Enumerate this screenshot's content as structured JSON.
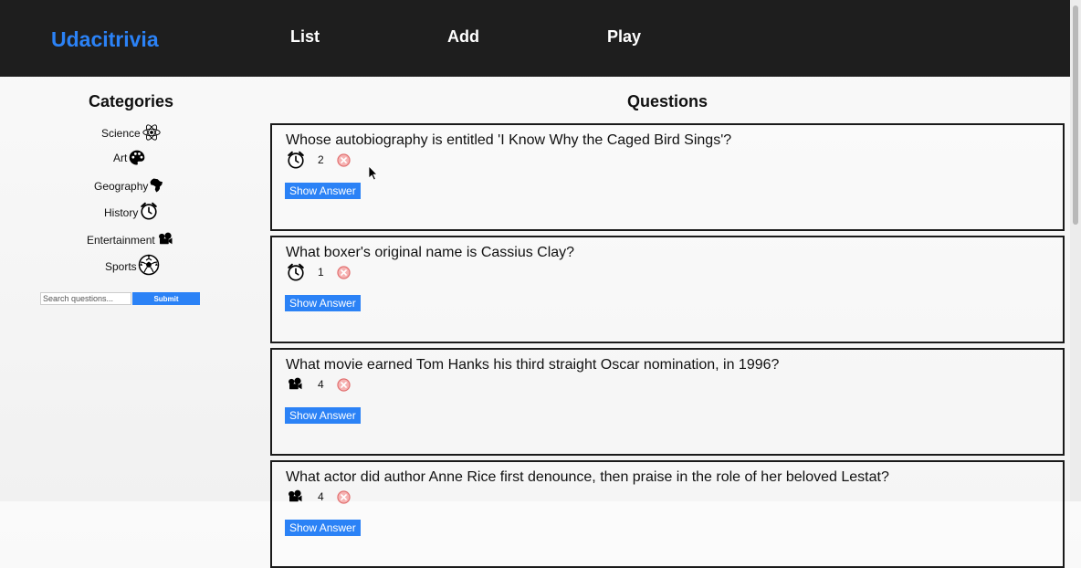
{
  "header": {
    "brand": "Udacitrivia",
    "nav": [
      {
        "label": "List"
      },
      {
        "label": "Add"
      },
      {
        "label": "Play"
      }
    ]
  },
  "sidebar": {
    "title": "Categories",
    "categories": [
      {
        "label": "Science",
        "icon": "atom-icon"
      },
      {
        "label": "Art",
        "icon": "palette-icon"
      },
      {
        "label": "Geography",
        "icon": "africa-map-icon"
      },
      {
        "label": "History",
        "icon": "alarm-clock-icon"
      },
      {
        "label": "Entertainment",
        "icon": "film-camera-icon"
      },
      {
        "label": "Sports",
        "icon": "soccer-ball-icon"
      }
    ],
    "search": {
      "placeholder": "Search questions...",
      "value": ""
    },
    "submit_label": "Submit"
  },
  "main": {
    "title": "Questions",
    "questions": [
      {
        "text": "Whose autobiography is entitled 'I Know Why the Caged Bird Sings'?",
        "category_icon": "alarm-clock-icon",
        "difficulty": "2",
        "button": "Show Answer"
      },
      {
        "text": "What boxer's original name is Cassius Clay?",
        "category_icon": "alarm-clock-icon",
        "difficulty": "1",
        "button": "Show Answer"
      },
      {
        "text": "What movie earned Tom Hanks his third straight Oscar nomination, in 1996?",
        "category_icon": "film-camera-icon",
        "difficulty": "4",
        "button": "Show Answer"
      },
      {
        "text": "What actor did author Anne Rice first denounce, then praise in the role of her beloved Lestat?",
        "category_icon": "film-camera-icon",
        "difficulty": "4",
        "button": "Show Answer"
      }
    ]
  },
  "colors": {
    "accent": "#2b82f6",
    "header_bg": "#1e1e1e",
    "delete": "#e06b6b"
  }
}
